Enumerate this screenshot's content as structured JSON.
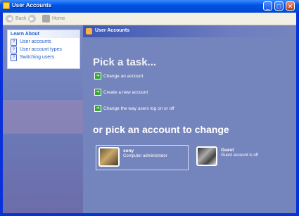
{
  "window": {
    "title": "User Accounts"
  },
  "titlebar_buttons": {
    "minimize": "_",
    "maximize": "□",
    "close": "✕"
  },
  "toolbar": {
    "back_label": "Back",
    "home_label": "Home"
  },
  "learn_about": {
    "heading": "Learn About",
    "items": [
      {
        "label": "User accounts"
      },
      {
        "label": "User account types"
      },
      {
        "label": "Switching users"
      }
    ]
  },
  "header": {
    "title": "User Accounts"
  },
  "main": {
    "pick_task": "Pick a task...",
    "tasks": [
      {
        "label": "Change an account"
      },
      {
        "label": "Create a new account"
      },
      {
        "label": "Change the way users log on or off"
      }
    ],
    "pick_account": "or pick an account to change",
    "accounts": [
      {
        "name": "sony",
        "type": "Computer administrator",
        "icon": "guitar-picture"
      },
      {
        "name": "Guest",
        "type": "Guest account is off",
        "icon": "guest-picture"
      }
    ]
  },
  "colors": {
    "accent": "#0831d9",
    "task_panel_bg": "#7484bd",
    "link": "#215dc6"
  }
}
